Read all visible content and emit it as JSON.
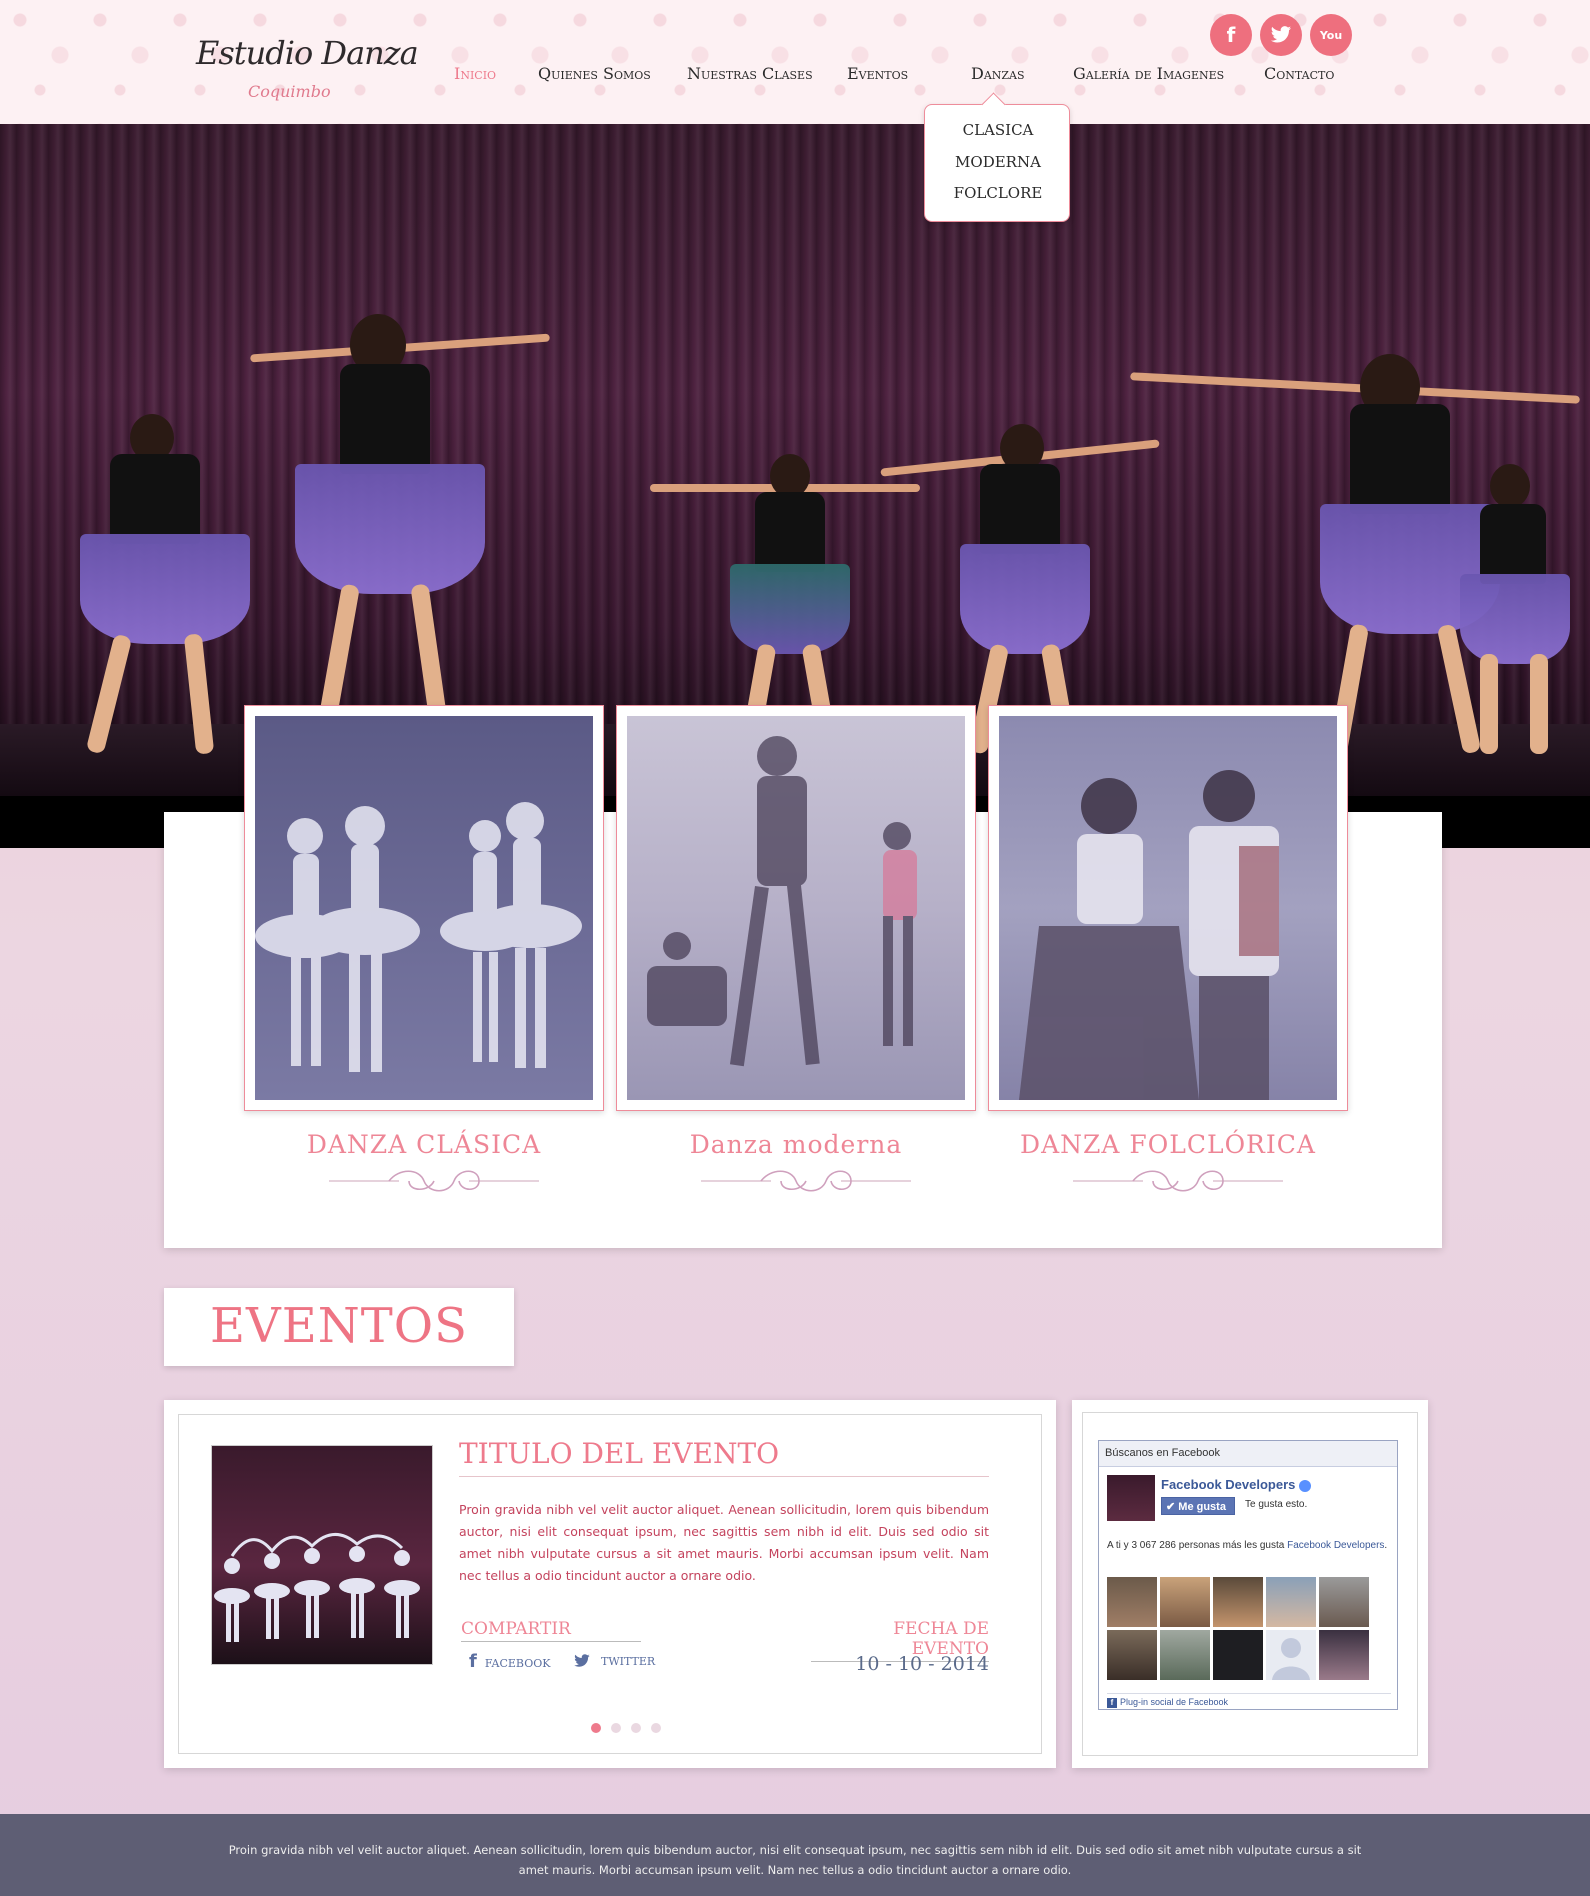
{
  "logo": {
    "main": "Estudio Danza",
    "sub": "Coquimbo"
  },
  "nav": {
    "items": [
      "Inicio",
      "Quienes Somos",
      "Nuestras Clases",
      "Eventos",
      "Danzas",
      "Galería de Imagenes",
      "Contacto"
    ],
    "active": "Inicio"
  },
  "social": {
    "facebook": "f",
    "twitter": "t",
    "youtube": "You"
  },
  "dropdown": {
    "items": [
      "CLASICA",
      "MODERNA",
      "FOLCLORE"
    ]
  },
  "cards": [
    {
      "title": "DANZA CLÁSICA"
    },
    {
      "title": "Danza moderna"
    },
    {
      "title": "DANZA FOLCLÓRICA"
    }
  ],
  "eventos": {
    "heading": "EVENTOS",
    "title": "TITULO DEL EVENTO",
    "text": "Proin gravida nibh vel velit auctor aliquet. Aenean sollicitudin, lorem quis bibendum auctor, nisi elit consequat ipsum, nec sagittis sem nibh id elit. Duis sed odio sit amet nibh vulputate cursus a sit amet mauris. Morbi accumsan ipsum velit. Nam nec tellus a odio tincidunt auctor a ornare odio.",
    "share_label": "COMPARTIR",
    "facebook_label": "facebook",
    "twitter_label": "twitter",
    "date_label": "FECHA DE EVENTO",
    "date_value": "10 - 10 - 2014",
    "slider_active_index": 0
  },
  "facebook_widget": {
    "header": "Búscanos en Facebook",
    "page_name": "Facebook Developers",
    "like_button": "Me gusta",
    "like_text": "Te gusta esto.",
    "count_text": "A ti y 3 067 286 personas más les gusta",
    "count_link": "Facebook Developers",
    "footer": "Plug-in social de Facebook"
  },
  "footer": {
    "text": "Proin gravida nibh vel velit auctor aliquet. Aenean sollicitudin, lorem quis bibendum auctor, nisi elit consequat ipsum, nec sagittis sem nibh id elit. Duis sed odio sit amet nibh vulputate cursus a sit amet mauris. Morbi accumsan ipsum velit. Nam nec tellus a odio tincidunt auctor a ornare odio."
  },
  "colors": {
    "accent": "#ee7a8c",
    "footer_bg": "#5e5e74",
    "link_blue": "#3b5998"
  }
}
